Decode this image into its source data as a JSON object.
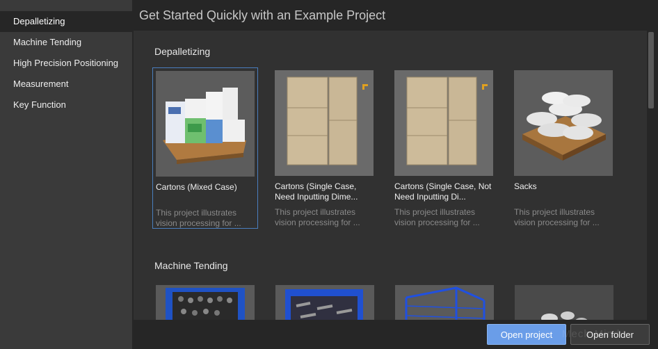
{
  "page_title": "Get Started Quickly with an Example Project",
  "sidebar": {
    "items": [
      {
        "label": "Depalletizing",
        "active": true
      },
      {
        "label": "Machine Tending",
        "active": false
      },
      {
        "label": "High Precision Positioning",
        "active": false
      },
      {
        "label": "Measurement",
        "active": false
      },
      {
        "label": "Key Function",
        "active": false
      }
    ]
  },
  "sections": [
    {
      "title": "Depalletizing",
      "cards": [
        {
          "title": "Cartons (Mixed Case)",
          "desc": "This project illustrates vision processing for ...",
          "thumbnail": "mixed-carton-pallet",
          "selected": true
        },
        {
          "title": "Cartons (Single Case, Need Inputting Dime...",
          "desc": "This project illustrates vision processing for ...",
          "thumbnail": "single-carton-top-view",
          "selected": false
        },
        {
          "title": "Cartons (Single Case, Not Need Inputting Di...",
          "desc": "This project illustrates vision processing for ...",
          "thumbnail": "single-carton-top-view",
          "selected": false
        },
        {
          "title": "Sacks",
          "desc": "This project illustrates vision processing for ...",
          "thumbnail": "sack-pallet",
          "selected": false
        }
      ]
    },
    {
      "title": "Machine Tending",
      "cards": [
        {
          "thumbnail": "blue-bin-parts"
        },
        {
          "thumbnail": "blue-basket-parts"
        },
        {
          "thumbnail": "blue-wire-basket"
        },
        {
          "thumbnail": "metal-parts"
        }
      ]
    }
  ],
  "footer": {
    "open_project_label": "Open project",
    "open_folder_label": "Open folder",
    "watermark": "Mech-Mind"
  },
  "colors": {
    "accent": "#6a9de8",
    "selection_border": "#4a7fbf",
    "sidebar_bg": "#3a3a3a",
    "content_bg": "#313131"
  }
}
